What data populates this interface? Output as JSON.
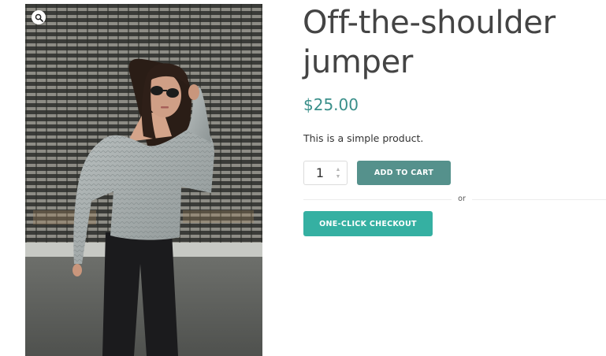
{
  "product": {
    "title": "Off-the-shoulder jumper",
    "price": "$25.00",
    "short_description": "This is a simple product.",
    "image_icon": "product-photo-woman-in-knit-jumper"
  },
  "gallery": {
    "zoom_icon": "magnifier-icon"
  },
  "cart_form": {
    "quantity_value": "1",
    "stepper_up_icon": "chevron-up-icon",
    "stepper_down_icon": "chevron-down-icon",
    "add_to_cart_label": "ADD TO CART",
    "separator_text": "or",
    "one_click_checkout_label": "ONE-CLICK CHECKOUT"
  },
  "colors": {
    "title_text": "#444444",
    "price": "#3a8f8a",
    "add_to_cart_bg": "#55918c",
    "one_click_bg": "#35b0a2",
    "button_text": "#ffffff"
  }
}
